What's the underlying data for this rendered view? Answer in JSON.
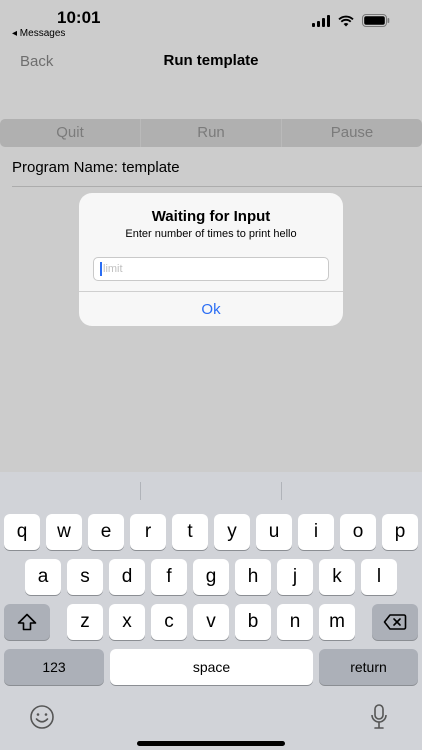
{
  "status": {
    "time": "10:01",
    "back_to_app": "◂ Messages"
  },
  "nav": {
    "back": "Back",
    "title": "Run template"
  },
  "controls": [
    "Quit",
    "Run",
    "Pause"
  ],
  "program": {
    "label": "Program Name: template"
  },
  "alert": {
    "title": "Waiting for Input",
    "message": "Enter number of times to print hello",
    "input_placeholder": "limit",
    "ok": "Ok"
  },
  "keyboard": {
    "row1": [
      "q",
      "w",
      "e",
      "r",
      "t",
      "y",
      "u",
      "i",
      "o",
      "p"
    ],
    "row2": [
      "a",
      "s",
      "d",
      "f",
      "g",
      "h",
      "j",
      "k",
      "l"
    ],
    "row3": [
      "z",
      "x",
      "c",
      "v",
      "b",
      "n",
      "m"
    ],
    "numbers": "123",
    "space": "space",
    "return": "return"
  },
  "colors": {
    "accent": "#2a6df4",
    "keyboard_bg": "#d1d3d8"
  }
}
